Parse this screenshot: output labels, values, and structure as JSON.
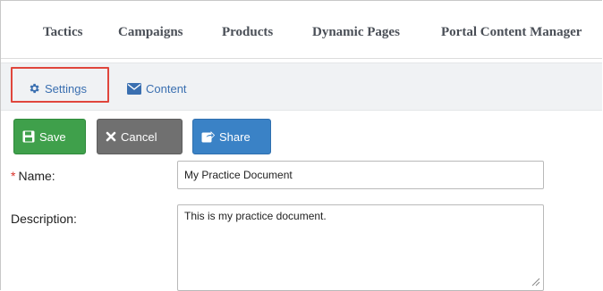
{
  "nav": {
    "items": [
      {
        "label": "Tactics"
      },
      {
        "label": "Campaigns"
      },
      {
        "label": "Products"
      },
      {
        "label": "Dynamic Pages"
      },
      {
        "label": "Portal Content Manager"
      }
    ]
  },
  "subnav": {
    "settings_label": "Settings",
    "content_label": "Content"
  },
  "toolbar": {
    "save_label": "Save",
    "cancel_label": "Cancel",
    "share_label": "Share"
  },
  "form": {
    "name_required_mark": "*",
    "name_label": "Name:",
    "name_value": "My Practice Document",
    "description_label": "Description:",
    "description_value": "This is my practice document."
  },
  "colors": {
    "save": "#3fa04b",
    "cancel": "#707070",
    "share": "#3a82c6",
    "highlight": "#e0463c",
    "link": "#3a6fb0"
  },
  "icons": {
    "settings": "gear-icon",
    "content": "envelope-icon",
    "save": "floppy-disk-icon",
    "cancel": "x-icon",
    "share": "share-icon"
  }
}
